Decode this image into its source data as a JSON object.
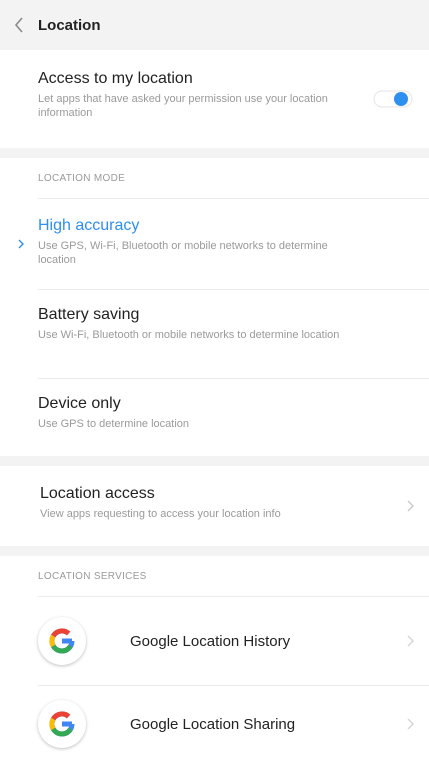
{
  "header": {
    "title": "Location",
    "back_icon": "chevron-left-icon"
  },
  "access": {
    "title": "Access to my location",
    "subtitle": "Let apps that have asked your permission use your location information",
    "enabled": true
  },
  "location_mode": {
    "label": "LOCATION MODE",
    "options": [
      {
        "title": "High accuracy",
        "subtitle": "Use GPS, Wi-Fi, Bluetooth or mobile networks to determine location",
        "selected": true
      },
      {
        "title": "Battery saving",
        "subtitle": "Use Wi-Fi, Bluetooth or mobile networks to determine location",
        "selected": false
      },
      {
        "title": "Device only",
        "subtitle": "Use GPS to determine location",
        "selected": false
      }
    ]
  },
  "location_access": {
    "title": "Location access",
    "subtitle": "View apps requesting to access your location info"
  },
  "location_services": {
    "label": "LOCATION SERVICES",
    "items": [
      {
        "label": "Google Location History",
        "icon": "google-g-icon"
      },
      {
        "label": "Google Location Sharing",
        "icon": "google-g-icon"
      }
    ]
  },
  "colors": {
    "accent": "#2d8ff0",
    "background": "#f3f3f3",
    "card": "#ffffff",
    "secondary_text": "#9a9a9a"
  }
}
